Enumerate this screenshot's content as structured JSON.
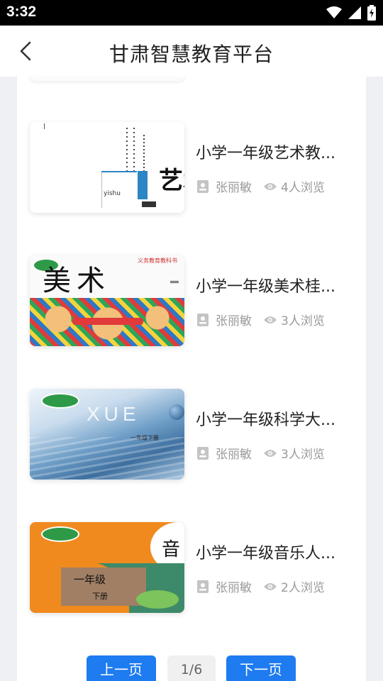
{
  "status_bar": {
    "time": "3:32"
  },
  "header": {
    "title": "甘肃智慧教育平台"
  },
  "items": [
    {
      "title": "小学一年级艺术教...",
      "author": "张丽敏",
      "views": "4人浏览",
      "cover_text": "艺术",
      "cover_sub": "yishu"
    },
    {
      "title": "小学一年级美术桂...",
      "author": "张丽敏",
      "views": "3人浏览",
      "cover_text": "美术",
      "cover_sub": "义务教育教科书"
    },
    {
      "title": "小学一年级科学大...",
      "author": "张丽敏",
      "views": "3人浏览",
      "cover_text": "XUE",
      "cover_sub": "一年级下册"
    },
    {
      "title": "小学一年级音乐人...",
      "author": "张丽敏",
      "views": "2人浏览",
      "cover_text": "音",
      "cover_sub": "一年级",
      "cover_sub2": "下册"
    }
  ],
  "pagination": {
    "prev_label": "上一页",
    "page_indicator": "1/6",
    "next_label": "下一页"
  },
  "colors": {
    "accent": "#1e7bf0",
    "background": "#eef0f4"
  }
}
